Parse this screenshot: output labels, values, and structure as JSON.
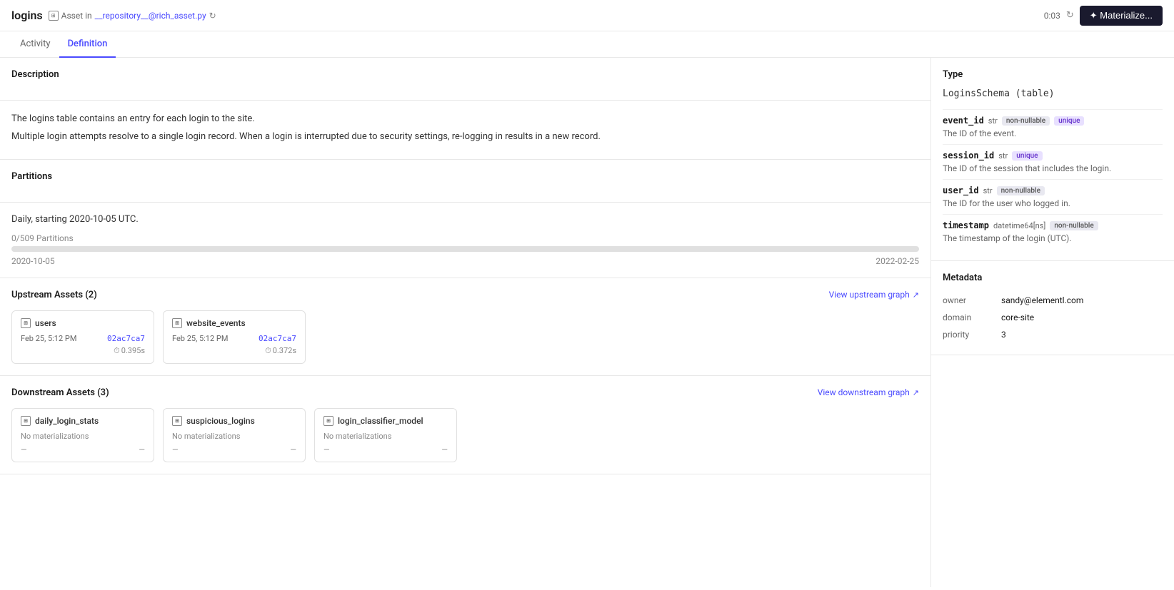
{
  "header": {
    "title": "logins",
    "asset_label": "Asset in",
    "asset_file": "__repository__@rich_asset.py",
    "timer": "0:03",
    "materialize_label": "✦ Materialize..."
  },
  "tabs": [
    {
      "id": "activity",
      "label": "Activity",
      "active": false
    },
    {
      "id": "definition",
      "label": "Definition",
      "active": true
    }
  ],
  "description_section": {
    "title": "Description",
    "lines": [
      "The logins table contains an entry for each login to the site.",
      "Multiple login attempts resolve to a single login record. When a login is interrupted due to security settings, re-logging in results in a new record."
    ]
  },
  "partitions_section": {
    "title": "Partitions",
    "schedule": "Daily, starting 2020-10-05 UTC.",
    "count_label": "0/509 Partitions",
    "date_start": "2020-10-05",
    "date_end": "2022-02-25",
    "progress_pct": 0
  },
  "upstream_section": {
    "title": "Upstream Assets (2)",
    "view_link": "View upstream graph",
    "assets": [
      {
        "name": "users",
        "date": "Feb 25, 5:12 PM",
        "hash": "02ac7ca7",
        "time": "0.395s"
      },
      {
        "name": "website_events",
        "date": "Feb 25, 5:12 PM",
        "hash": "02ac7ca7",
        "time": "0.372s"
      }
    ]
  },
  "downstream_section": {
    "title": "Downstream Assets (3)",
    "view_link": "View downstream graph",
    "assets": [
      {
        "name": "daily_login_stats",
        "no_mat": "No materializations",
        "dash1": "—",
        "dash2": "—"
      },
      {
        "name": "suspicious_logins",
        "no_mat": "No materializations",
        "dash1": "—",
        "dash2": "—"
      },
      {
        "name": "login_classifier_model",
        "no_mat": "No materializations",
        "dash1": "—",
        "dash2": "—"
      }
    ]
  },
  "type_section": {
    "title": "Type",
    "schema_name": "LoginsSchema (table)",
    "fields": [
      {
        "name": "event_id",
        "type": "str",
        "badges": [
          "non-nullable",
          "unique"
        ],
        "desc": "The ID of the event."
      },
      {
        "name": "session_id",
        "type": "str",
        "badges": [
          "unique"
        ],
        "desc": "The ID of the session that includes the login."
      },
      {
        "name": "user_id",
        "type": "str",
        "badges": [
          "non-nullable"
        ],
        "desc": "The ID for the user who logged in."
      },
      {
        "name": "timestamp",
        "type": "datetime64[ns]",
        "badges": [
          "non-nullable"
        ],
        "desc": "The timestamp of the login (UTC)."
      }
    ]
  },
  "metadata_section": {
    "title": "Metadata",
    "rows": [
      {
        "key": "owner",
        "value": "sandy@elementl.com"
      },
      {
        "key": "domain",
        "value": "core-site"
      },
      {
        "key": "priority",
        "value": "3"
      }
    ]
  }
}
